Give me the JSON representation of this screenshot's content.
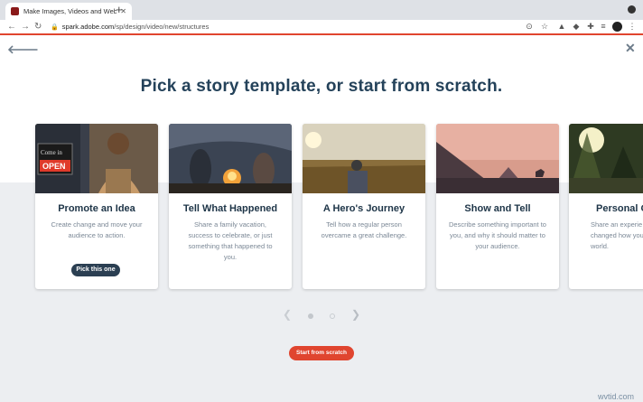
{
  "browser": {
    "tab_title": "Make Images, Videos and Web",
    "url_host": "spark.adobe.com",
    "url_path": "/sp/design/video/new/structures"
  },
  "page": {
    "heading": "Pick a story template, or start from scratch.",
    "cards": [
      {
        "title": "Promote an Idea",
        "description": "Create change and move your audience to action.",
        "button": "Pick this one"
      },
      {
        "title": "Tell What Happened",
        "description": "Share a family vacation, success to celebrate, or just something that happened to you."
      },
      {
        "title": "A Hero's Journey",
        "description": "Tell how a regular person overcame a great challenge."
      },
      {
        "title": "Show and Tell",
        "description": "Describe something important to you, and why it should matter to your audience."
      },
      {
        "title": "Personal Gr",
        "description": "Share an experie changed how you world."
      }
    ],
    "start_button": "Start from scratch",
    "watermark": "wvtid.com"
  },
  "colors": {
    "accent": "#e0452f",
    "heading": "#24425a",
    "button_dark": "#2b3f52"
  }
}
